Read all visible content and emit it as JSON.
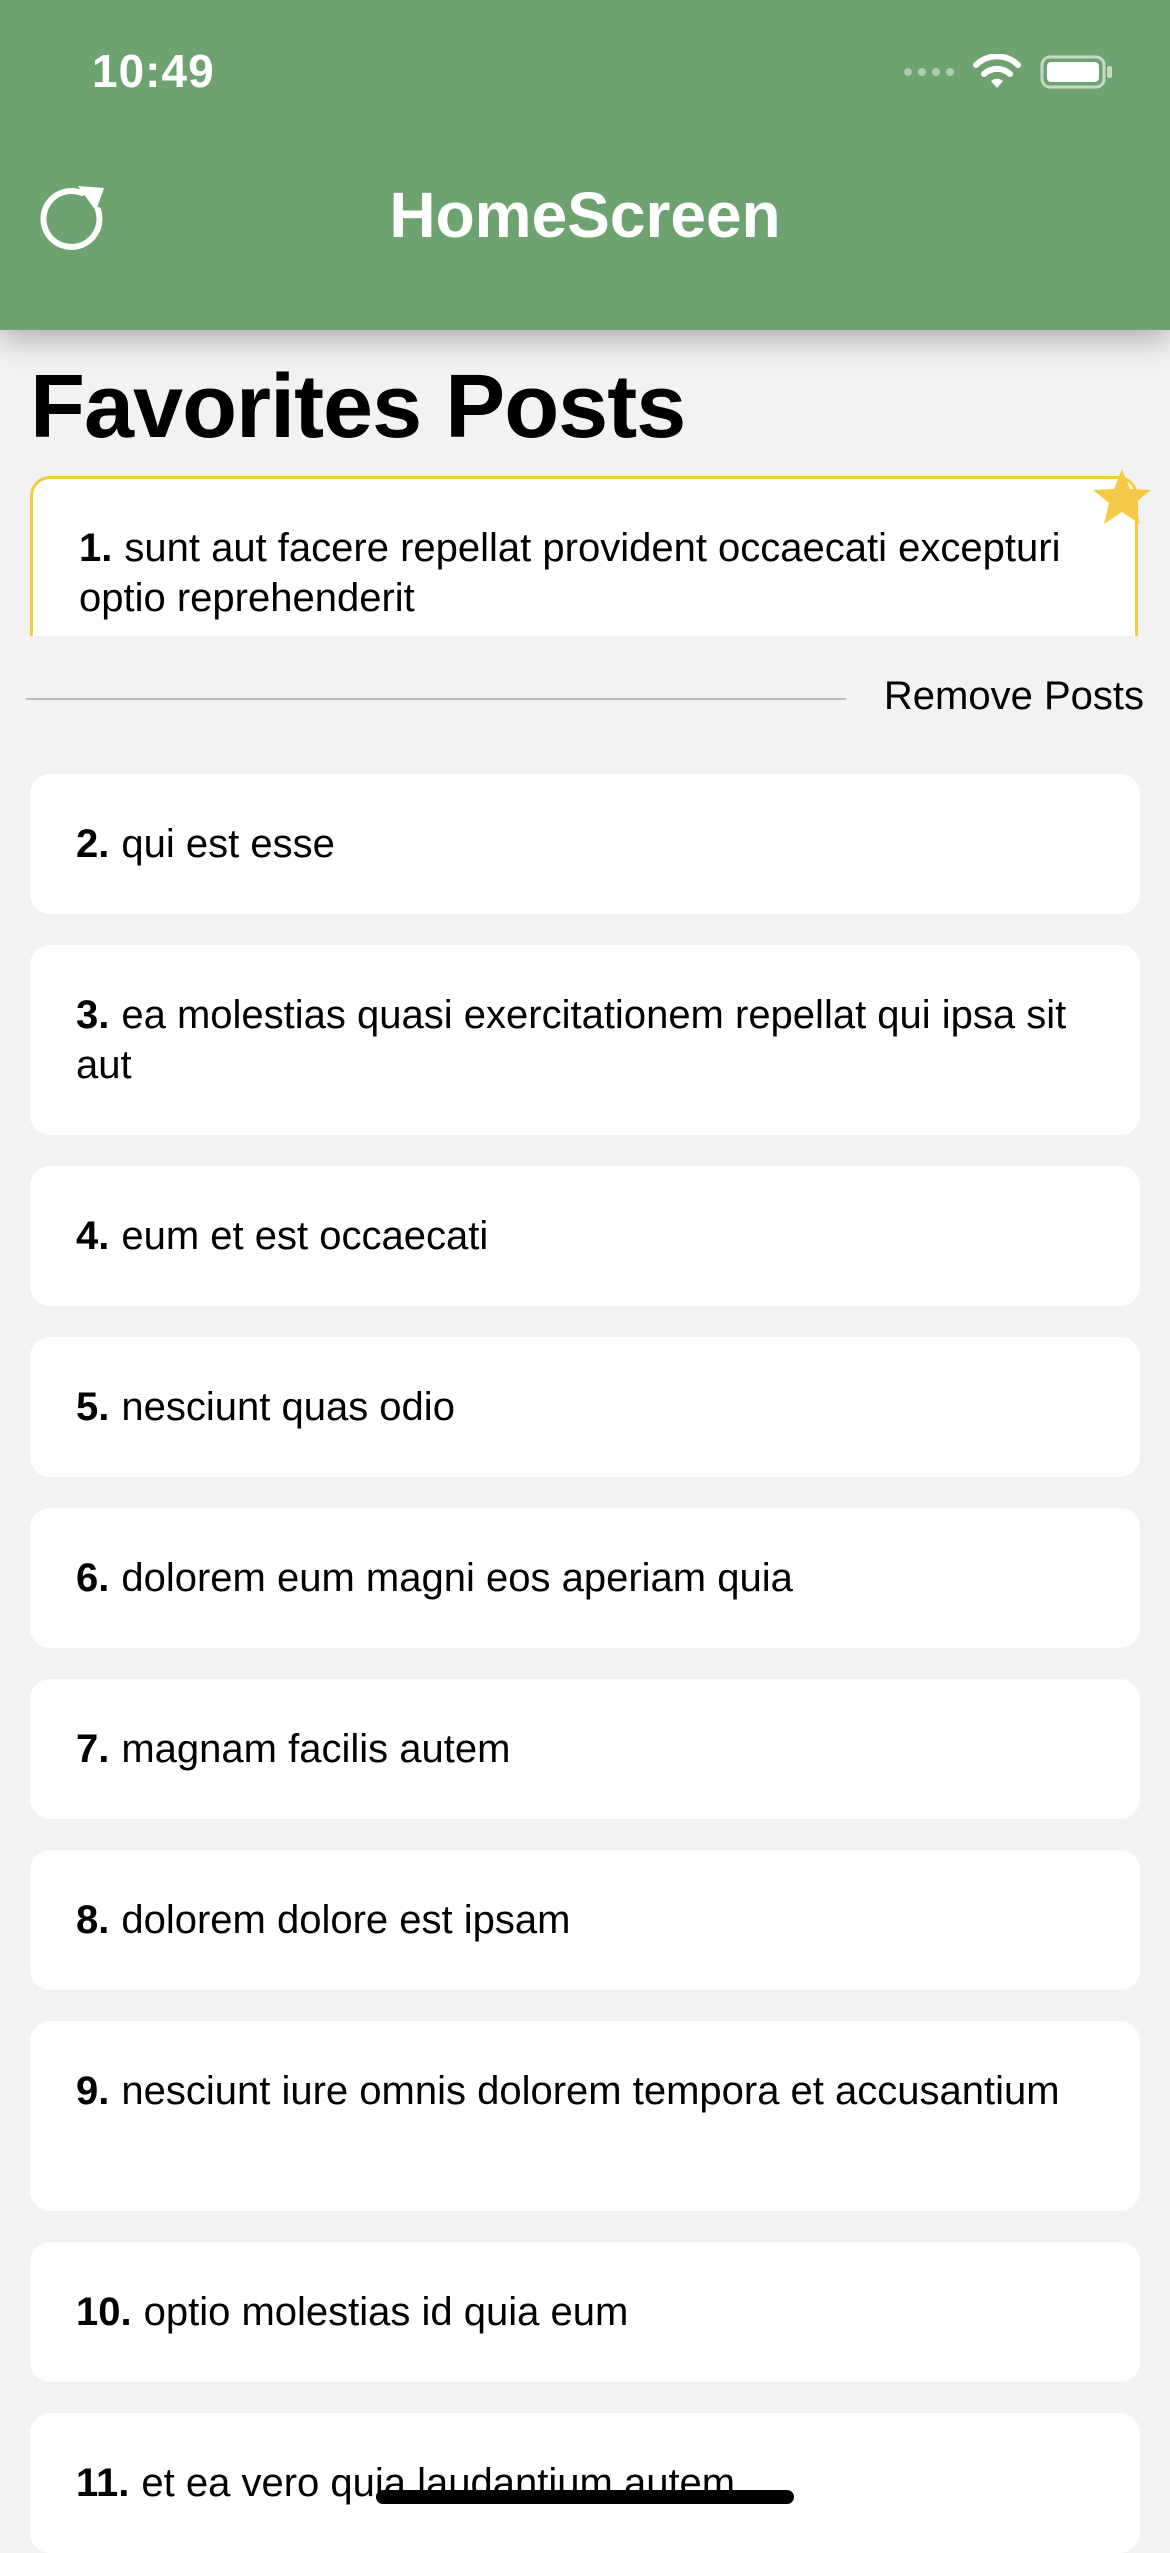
{
  "status_bar": {
    "time": "10:49"
  },
  "header": {
    "title": "HomeScreen",
    "refresh_icon": "refresh-icon"
  },
  "favorites": {
    "heading": "Favorites Posts",
    "star_color": "#f7c948",
    "items": [
      {
        "number": "1.",
        "title": "sunt aut facere repellat provident occaecati excepturi optio reprehenderit"
      }
    ]
  },
  "actions": {
    "remove_posts_label": "Remove Posts"
  },
  "posts": [
    {
      "number": "2.",
      "title": "qui est esse"
    },
    {
      "number": "3.",
      "title": "ea molestias quasi exercitationem repellat qui ipsa sit aut"
    },
    {
      "number": "4.",
      "title": "eum et est occaecati"
    },
    {
      "number": "5.",
      "title": "nesciunt quas odio"
    },
    {
      "number": "6.",
      "title": "dolorem eum magni eos aperiam quia"
    },
    {
      "number": "7.",
      "title": "magnam facilis autem"
    },
    {
      "number": "8.",
      "title": "dolorem dolore est ipsam"
    },
    {
      "number": "9.",
      "title": "nesciunt iure omnis dolorem tempora et accusantium"
    },
    {
      "number": "10.",
      "title": "optio molestias id quia eum"
    },
    {
      "number": "11.",
      "title": "et ea vero quia laudantium autem"
    }
  ],
  "colors": {
    "header_bg": "#6ea270",
    "favorite_border": "#f3cc3b"
  }
}
